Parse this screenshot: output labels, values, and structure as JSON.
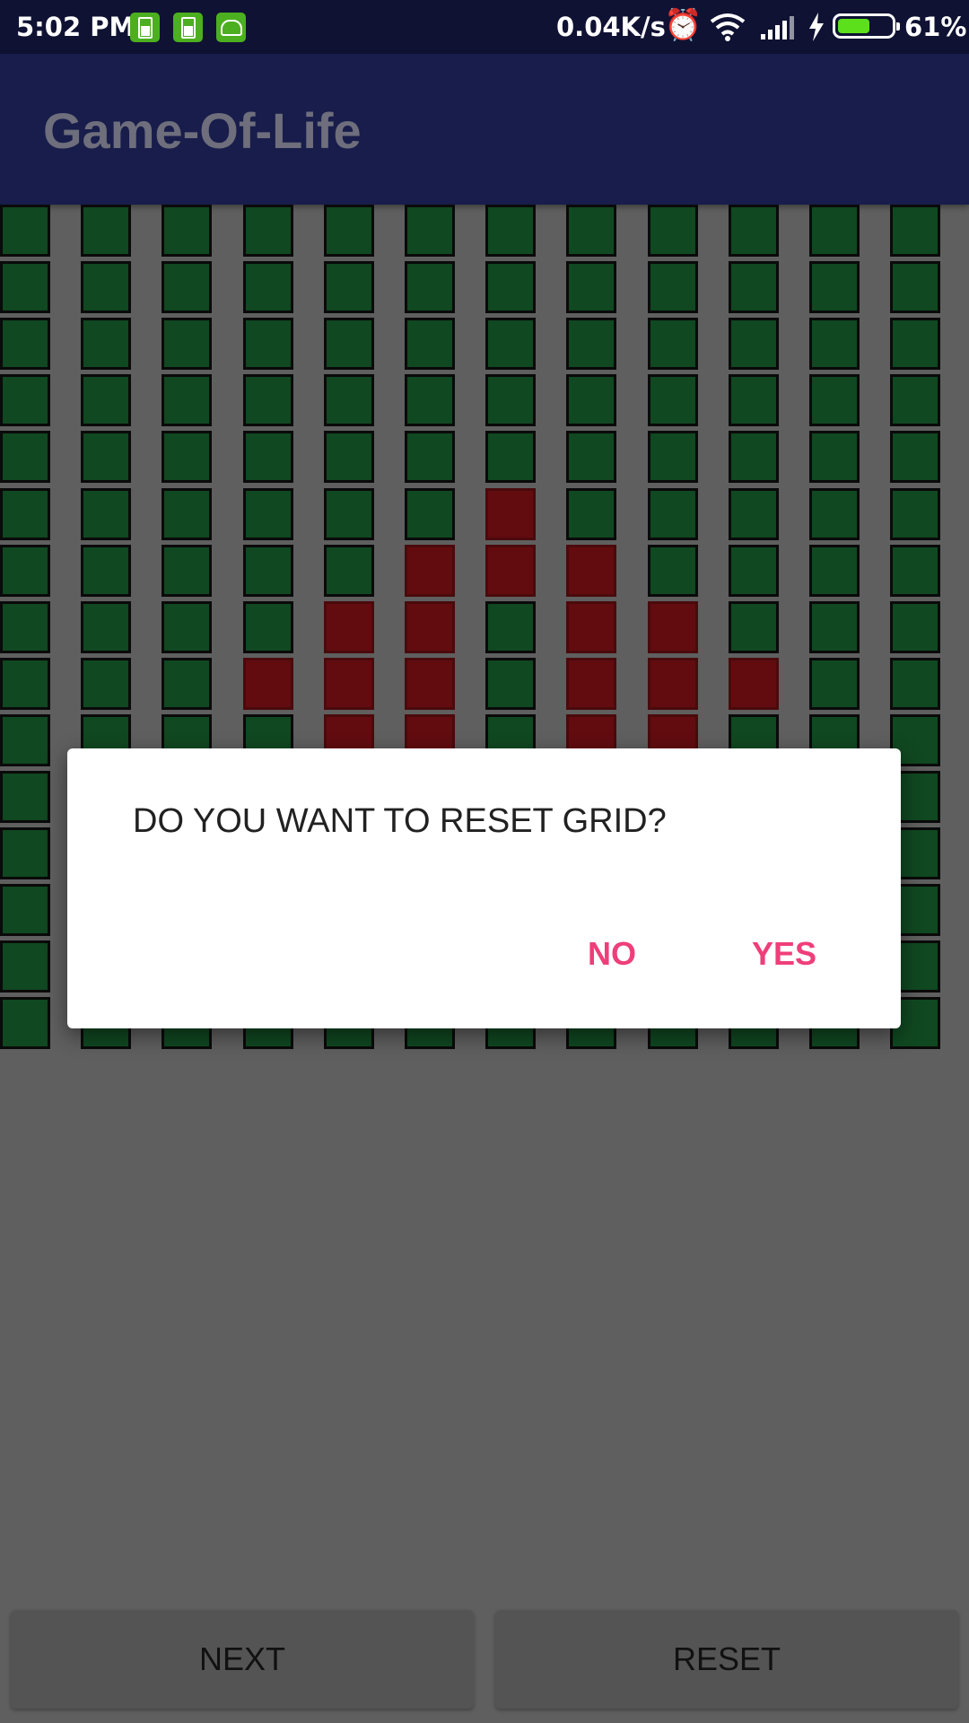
{
  "status_bar": {
    "time": "5:02 PM",
    "network_speed": "0.04K/s",
    "battery_percent": "61%",
    "battery_level": 0.61,
    "icons": [
      "battery-notification-icon",
      "battery-notification-icon",
      "android-notification-icon",
      "alarm-icon",
      "wifi-icon",
      "signal-icon",
      "charging-icon",
      "battery-icon"
    ]
  },
  "app_bar": {
    "title": "Game-Of-Life"
  },
  "grid": {
    "columns": 12,
    "rows": 15,
    "colors": {
      "dead": "#104821",
      "alive": "#620c10"
    },
    "alive_cells": [
      [
        5,
        6
      ],
      [
        6,
        5
      ],
      [
        6,
        6
      ],
      [
        6,
        7
      ],
      [
        7,
        4
      ],
      [
        7,
        5
      ],
      [
        7,
        7
      ],
      [
        7,
        8
      ],
      [
        8,
        3
      ],
      [
        8,
        4
      ],
      [
        8,
        5
      ],
      [
        8,
        7
      ],
      [
        8,
        8
      ],
      [
        8,
        9
      ],
      [
        9,
        4
      ],
      [
        9,
        5
      ],
      [
        9,
        7
      ],
      [
        9,
        8
      ]
    ]
  },
  "dialog": {
    "message": "DO YOU WANT TO RESET GRID?",
    "no_label": "NO",
    "yes_label": "YES",
    "accent_color": "#ee3f7a"
  },
  "bottom_buttons": {
    "next_label": "NEXT",
    "reset_label": "RESET"
  }
}
